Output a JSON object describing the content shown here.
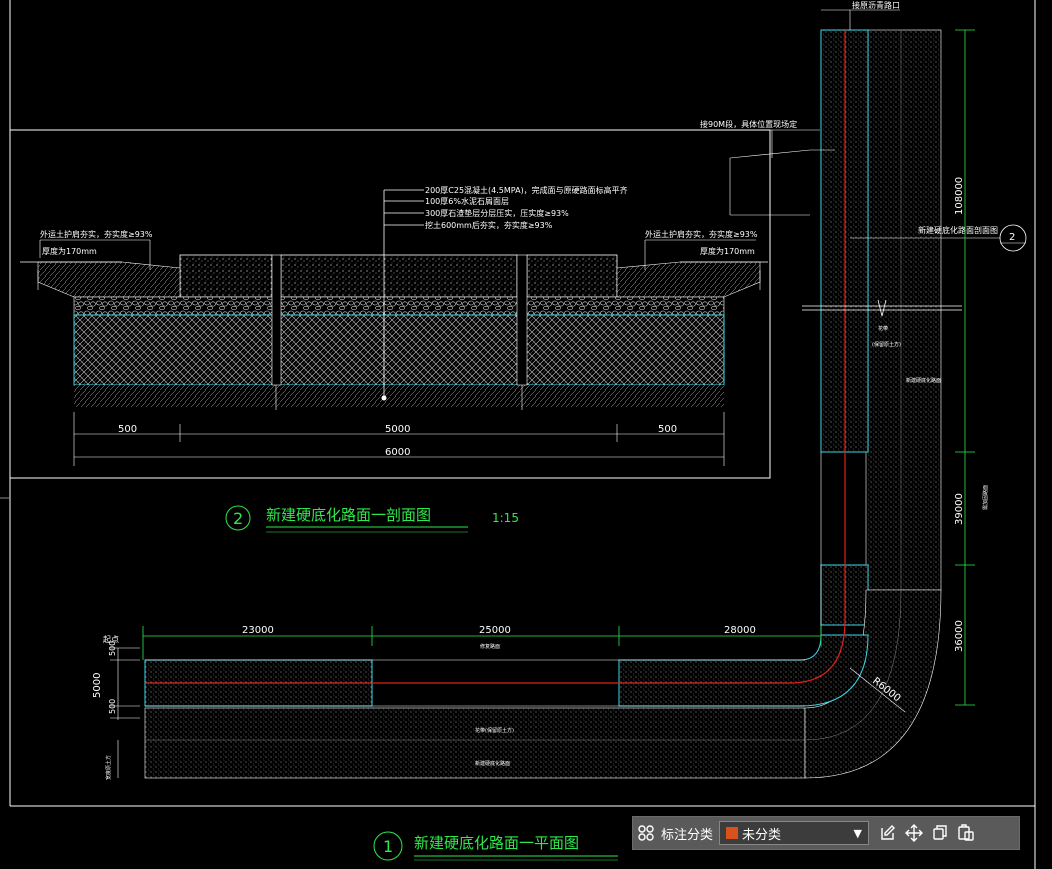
{
  "drawing": {
    "section": {
      "title": "新建硬底化路面一剖面图",
      "number": "2",
      "scale": "1:15",
      "layers": [
        "200厚C25混凝土(4.5MPA)，完成面与原硬路面标高平齐",
        "100厚6%水泥石屑面层",
        "300厚石渣垫层分层压实，压实度≥93%",
        "挖土600mm后夯实，夯实度≥93%"
      ],
      "left_note_1": "外运土护肩夯实，夯实度≥93%",
      "left_note_2": "厚度为170mm",
      "right_note_1": "外运土护肩夯实，夯实度≥93%",
      "right_note_2": "厚度为170mm",
      "dims": [
        "500",
        "5000",
        "500",
        "6000"
      ]
    },
    "plan": {
      "title": "新建硬底化路面一平面图",
      "number": "1",
      "top_label": "接原沥青路口",
      "pipe_note": "接90M段，具体位置现场定",
      "section_ref": "新建硬底化路面剖面图",
      "section_ref_num": "2",
      "start_label": "起点",
      "h_dims": [
        "23000",
        "25000",
        "28000"
      ],
      "v_dims_right": [
        "108000",
        "39000",
        "36000"
      ],
      "left_dims": [
        "500",
        "5000",
        "500"
      ],
      "radius": "R6000",
      "tiny_labels": [
        "修复路面",
        "花带",
        "(保留原土方)",
        "新建硬底化路面",
        "需加固路面",
        "花带(保留原土方)",
        "新建硬底化路面",
        "宽度原土方"
      ]
    }
  },
  "toolbar": {
    "label": "标注分类",
    "select_value": "未分类",
    "icons": [
      "grid-icon",
      "edit-icon",
      "move-icon",
      "copy-icon",
      "paste-icon"
    ]
  }
}
